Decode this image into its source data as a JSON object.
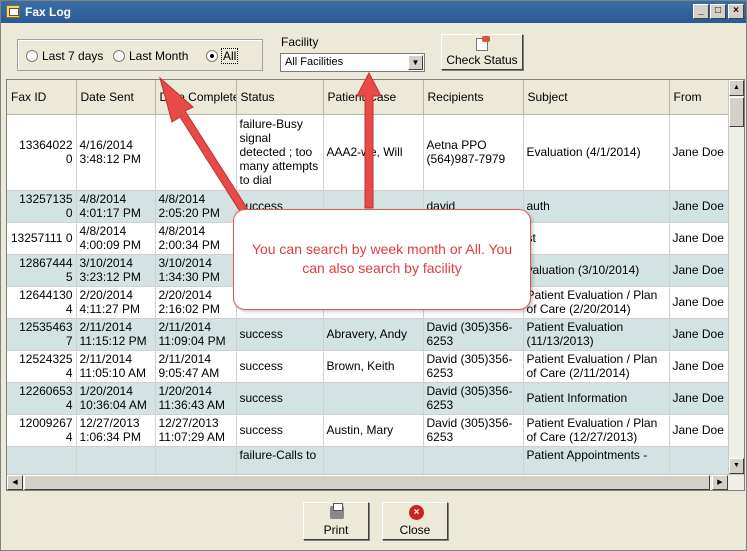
{
  "window": {
    "title": "Fax Log",
    "controls": {
      "minimize": "_",
      "maximize": "□",
      "close": "×"
    }
  },
  "filters": {
    "radios": [
      {
        "label": "Last 7 days",
        "selected": false
      },
      {
        "label": "Last Month",
        "selected": false
      },
      {
        "label": "All",
        "selected": true
      }
    ],
    "facility_label": "Facility",
    "facility_value": "All Facilities",
    "check_status_label": "Check Status"
  },
  "table": {
    "columns": [
      "Fax ID",
      "Date Sent",
      "Date Complete",
      "Status",
      "Patient Case",
      "Recipients",
      "Subject",
      "From"
    ],
    "rows": [
      {
        "fax_id": "13364022 0",
        "date_sent": "4/16/2014 3:48:12 PM",
        "date_complete": "",
        "status": "failure-Busy signal detected ; too many attempts to dial",
        "patient": "AAA2-we, Will",
        "recipients": "Aetna PPO (564)987-7979",
        "subject": "Evaluation (4/1/2014)",
        "from": "Jane Doe"
      },
      {
        "fax_id": "13257135 0",
        "date_sent": "4/8/2014 4:01:17 PM",
        "date_complete": "4/8/2014 2:05:20 PM",
        "status": "success",
        "patient": "",
        "recipients": "david",
        "subject": "auth",
        "from": "Jane Doe"
      },
      {
        "fax_id": "13257111 0",
        "date_sent": "4/8/2014 4:00:09 PM",
        "date_complete": "4/8/2014 2:00:34 PM",
        "status": "",
        "patient": "",
        "recipients": "",
        "subject": "st",
        "from": "Jane Doe"
      },
      {
        "fax_id": "12867444 5",
        "date_sent": "3/10/2014 3:23:12 PM",
        "date_complete": "3/10/2014 1:34:30 PM",
        "status": "",
        "patient": "",
        "recipients": "",
        "subject": "valuation (3/10/2014)",
        "from": "Jane Doe"
      },
      {
        "fax_id": "12644130 4",
        "date_sent": "2/20/2014 4:11:27 PM",
        "date_complete": "2/20/2014 2:16:02 PM",
        "status": "",
        "patient": "",
        "recipients": "(305)356-6253",
        "subject": "Patient Evaluation / Plan of Care (2/20/2014)",
        "from": "Jane Doe"
      },
      {
        "fax_id": "12535463 7",
        "date_sent": "2/11/2014 11:15:12 PM",
        "date_complete": "2/11/2014 11:09:04 PM",
        "status": "success",
        "patient": "Abravery, Andy",
        "recipients": "David (305)356-6253",
        "subject": "Patient Evaluation (11/13/2013)",
        "from": "Jane Doe"
      },
      {
        "fax_id": "12524325 4",
        "date_sent": "2/11/2014 11:05:10 AM",
        "date_complete": "2/11/2014 9:05:47 AM",
        "status": "success",
        "patient": "Brown, Keith",
        "recipients": "David (305)356-6253",
        "subject": "Patient Evaluation / Plan of Care (2/11/2014)",
        "from": "Jane Doe"
      },
      {
        "fax_id": "12260653 4",
        "date_sent": "1/20/2014 10:36:04 AM",
        "date_complete": "1/20/2014 11:36:43 AM",
        "status": "success",
        "patient": "",
        "recipients": "David (305)356-6253",
        "subject": "Patient Information",
        "from": "Jane Doe"
      },
      {
        "fax_id": "12009267 4",
        "date_sent": "12/27/2013 1:06:34 PM",
        "date_complete": "12/27/2013 11:07:29 AM",
        "status": "success",
        "patient": "Austin, Mary",
        "recipients": "David (305)356-6253",
        "subject": "Patient Evaluation / Plan of Care (12/27/2013)",
        "from": "Jane Doe"
      },
      {
        "fax_id": "",
        "date_sent": "",
        "date_complete": "",
        "status": "failure-Calls to",
        "patient": "",
        "recipients": "",
        "subject": "Patient Appointments -",
        "from": ""
      }
    ]
  },
  "footer": {
    "print_label": "Print",
    "close_label": "Close"
  },
  "annotation": {
    "text": "You can search by week month or All. You can also search by facility",
    "color": "#e43b3b"
  }
}
